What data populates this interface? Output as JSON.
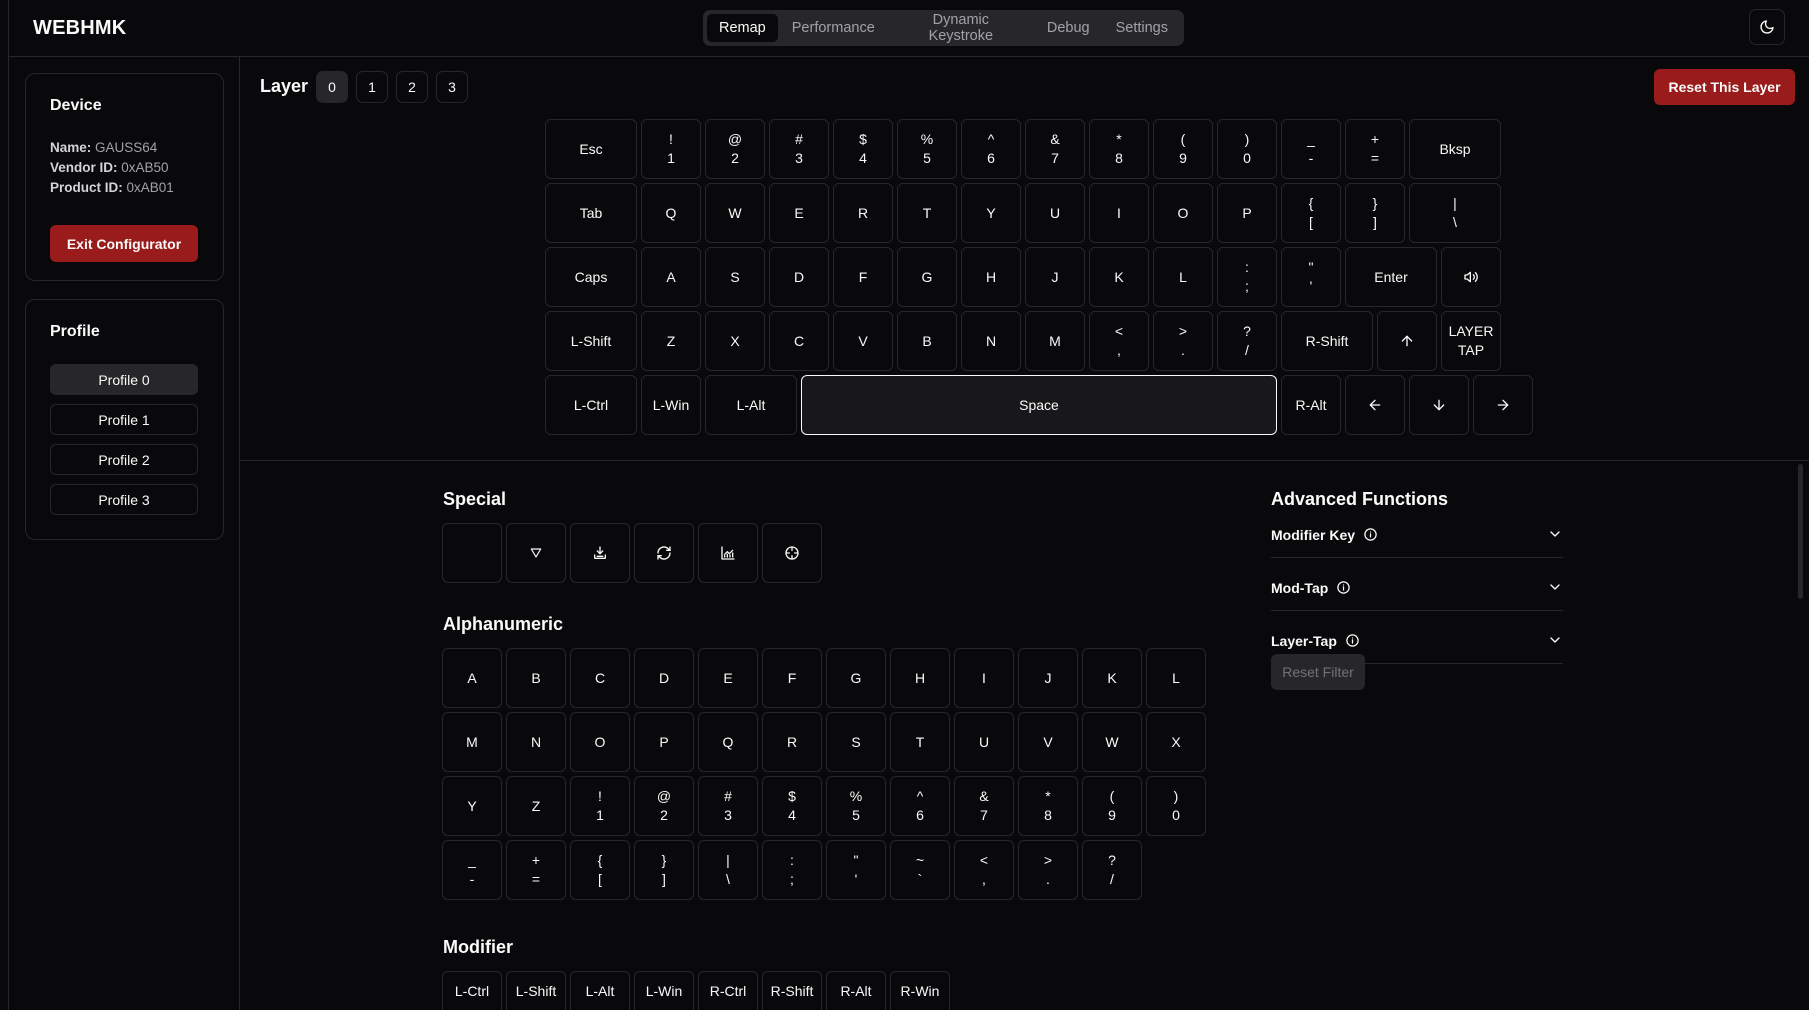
{
  "app": {
    "brand": "WEBHMK"
  },
  "tabs": [
    "Remap",
    "Performance",
    "Dynamic Keystroke",
    "Debug",
    "Settings"
  ],
  "device": {
    "title": "Device",
    "name_label": "Name:",
    "name": "GAUSS64",
    "vendor_label": "Vendor ID:",
    "vendor": "0xAB50",
    "product_label": "Product ID:",
    "product": "0xAB01",
    "exit_label": "Exit Configurator"
  },
  "profile": {
    "title": "Profile",
    "items": [
      "Profile 0",
      "Profile 1",
      "Profile 2",
      "Profile 3"
    ],
    "active": 0
  },
  "layer": {
    "label": "Layer",
    "items": [
      "0",
      "1",
      "2",
      "3"
    ],
    "active": 0,
    "reset_label": "Reset This Layer"
  },
  "keyboard": {
    "rows": [
      [
        [
          "Esc"
        ],
        [
          "!",
          "1"
        ],
        [
          "@",
          "2"
        ],
        [
          "#",
          "3"
        ],
        [
          "$",
          "4"
        ],
        [
          "%",
          "5"
        ],
        [
          "^",
          "6"
        ],
        [
          "&",
          "7"
        ],
        [
          "*",
          "8"
        ],
        [
          "(",
          "9"
        ],
        [
          ")",
          "0"
        ],
        [
          "_",
          "-"
        ],
        [
          "+",
          "="
        ],
        [
          "Bksp"
        ]
      ],
      [
        [
          "Tab"
        ],
        [
          "Q"
        ],
        [
          "W"
        ],
        [
          "E"
        ],
        [
          "R"
        ],
        [
          "T"
        ],
        [
          "Y"
        ],
        [
          "U"
        ],
        [
          "I"
        ],
        [
          "O"
        ],
        [
          "P"
        ],
        [
          "{",
          "["
        ],
        [
          "}",
          "]"
        ],
        [
          "|",
          "\\"
        ]
      ],
      [
        [
          "Caps"
        ],
        [
          "A"
        ],
        [
          "S"
        ],
        [
          "D"
        ],
        [
          "F"
        ],
        [
          "G"
        ],
        [
          "H"
        ],
        [
          "J"
        ],
        [
          "K"
        ],
        [
          "L"
        ],
        [
          ":",
          ";"
        ],
        [
          "\"",
          "'"
        ],
        [
          "Enter"
        ],
        [
          "volume-icon"
        ]
      ],
      [
        [
          "L-Shift"
        ],
        [
          "Z"
        ],
        [
          "X"
        ],
        [
          "C"
        ],
        [
          "V"
        ],
        [
          "B"
        ],
        [
          "N"
        ],
        [
          "M"
        ],
        [
          "<",
          ","
        ],
        [
          ">",
          "."
        ],
        [
          "?",
          "/"
        ],
        [
          "R-Shift"
        ],
        [
          "arrow-up-icon"
        ],
        [
          "LAYER",
          "TAP"
        ]
      ],
      [
        [
          "L-Ctrl"
        ],
        [
          "L-Win"
        ],
        [
          "L-Alt"
        ],
        [
          "Space"
        ],
        [
          "R-Alt"
        ],
        [
          "arrow-left-icon"
        ],
        [
          "arrow-down-icon"
        ],
        [
          "arrow-right-icon"
        ]
      ]
    ]
  },
  "sections": {
    "special": {
      "title": "Special",
      "icons": [
        "blank-icon",
        "transparent-triangle-icon",
        "upload-icon",
        "refresh-icon",
        "chart-icon",
        "crosshair-icon"
      ]
    },
    "alphanumeric": {
      "title": "Alphanumeric",
      "rows": [
        [
          [
            "A"
          ],
          [
            "B"
          ],
          [
            "C"
          ],
          [
            "D"
          ],
          [
            "E"
          ],
          [
            "F"
          ],
          [
            "G"
          ],
          [
            "H"
          ],
          [
            "I"
          ],
          [
            "J"
          ],
          [
            "K"
          ],
          [
            "L"
          ]
        ],
        [
          [
            "M"
          ],
          [
            "N"
          ],
          [
            "O"
          ],
          [
            "P"
          ],
          [
            "Q"
          ],
          [
            "R"
          ],
          [
            "S"
          ],
          [
            "T"
          ],
          [
            "U"
          ],
          [
            "V"
          ],
          [
            "W"
          ],
          [
            "X"
          ]
        ],
        [
          [
            "Y"
          ],
          [
            "Z"
          ],
          [
            "!",
            "1"
          ],
          [
            "@",
            "2"
          ],
          [
            "#",
            "3"
          ],
          [
            "$",
            "4"
          ],
          [
            "%",
            "5"
          ],
          [
            "^",
            "6"
          ],
          [
            "&",
            "7"
          ],
          [
            "*",
            "8"
          ],
          [
            "(",
            "9"
          ],
          [
            ")",
            "0"
          ]
        ],
        [
          [
            "_",
            "-"
          ],
          [
            "+",
            "="
          ],
          [
            "{",
            "["
          ],
          [
            "}",
            "]"
          ],
          [
            "|",
            "\\"
          ],
          [
            ":",
            ";"
          ],
          [
            "\"",
            "'"
          ],
          [
            "~",
            "`"
          ],
          [
            "<",
            ","
          ],
          [
            ">",
            "."
          ],
          [
            "?",
            "/"
          ]
        ]
      ]
    },
    "modifier": {
      "title": "Modifier",
      "keys": [
        "L-Ctrl",
        "L-Shift",
        "L-Alt",
        "L-Win",
        "R-Ctrl",
        "R-Shift",
        "R-Alt",
        "R-Win"
      ]
    }
  },
  "advanced": {
    "title": "Advanced Functions",
    "items": [
      "Modifier Key",
      "Mod-Tap",
      "Layer-Tap"
    ],
    "reset_filter": "Reset Filter"
  }
}
